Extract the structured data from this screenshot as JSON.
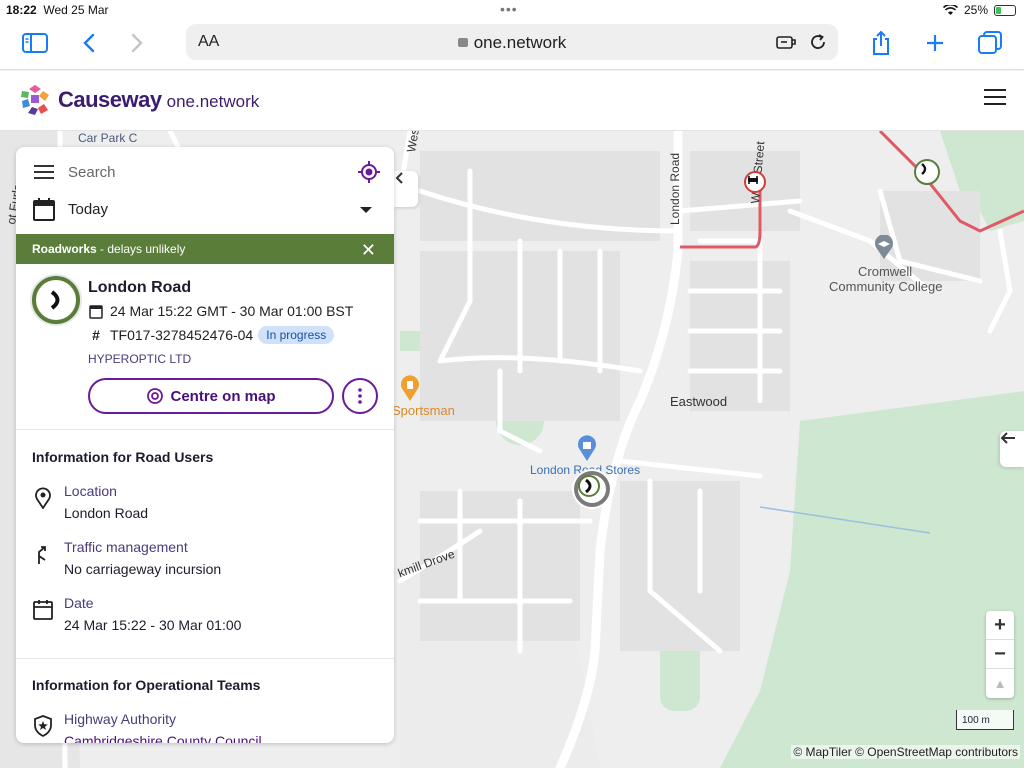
{
  "status_bar": {
    "time": "18:22",
    "date": "Wed 25 Mar",
    "battery": "25%"
  },
  "browser": {
    "aa_label": "AA",
    "url": "one.network"
  },
  "site": {
    "brand": "Causeway",
    "brand_sub": "one.network"
  },
  "panel": {
    "search_placeholder": "Search",
    "date_filter": "Today",
    "alert": {
      "category": "Roadworks",
      "detail": " - delays unlikely"
    },
    "work": {
      "title": "London Road",
      "dates": "24 Mar 15:22 GMT - 30 Mar 01:00 BST",
      "reference": "TF017-3278452476-04",
      "status": "In progress",
      "organisation": "HYPEROPTIC LTD",
      "centre_button": "Centre on map"
    },
    "road_users": {
      "heading": "Information for Road Users",
      "items": [
        {
          "label": "Location",
          "value": "London Road",
          "icon": "location-pin-icon"
        },
        {
          "label": "Traffic management",
          "value": "No carriageway incursion",
          "icon": "traffic-management-icon"
        },
        {
          "label": "Date",
          "value": "24 Mar 15:22 - 30 Mar 01:00",
          "icon": "calendar-icon"
        }
      ]
    },
    "operational": {
      "heading": "Information for Operational Teams",
      "items": [
        {
          "label": "Highway Authority",
          "value": "Cambridgeshire County Council",
          "icon": "shield-star-icon"
        }
      ]
    }
  },
  "map": {
    "labels": {
      "car_park": "Car Park C",
      "west_st": "West St",
      "london_road": "London Road",
      "west_street": "West Street",
      "cromwell": "Cromwell",
      "community_college": "Community College",
      "eastwood": "Eastwood",
      "sportsman": "Sportsman",
      "stores": "London Road Stores",
      "mill_drove": "kmill Drove",
      "furlong": "ot Furlon"
    },
    "controls": {
      "zoom_in": "+",
      "zoom_out": "−",
      "compass": "▲"
    },
    "scale": "100 m",
    "attribution": "© MapTiler © OpenStreetMap contributors"
  },
  "colors": {
    "brand_purple": "#6a1b9a",
    "roadworks_green": "#5a7d3a",
    "status_blue": "#cfe1fb",
    "route_red": "#e05a66"
  }
}
